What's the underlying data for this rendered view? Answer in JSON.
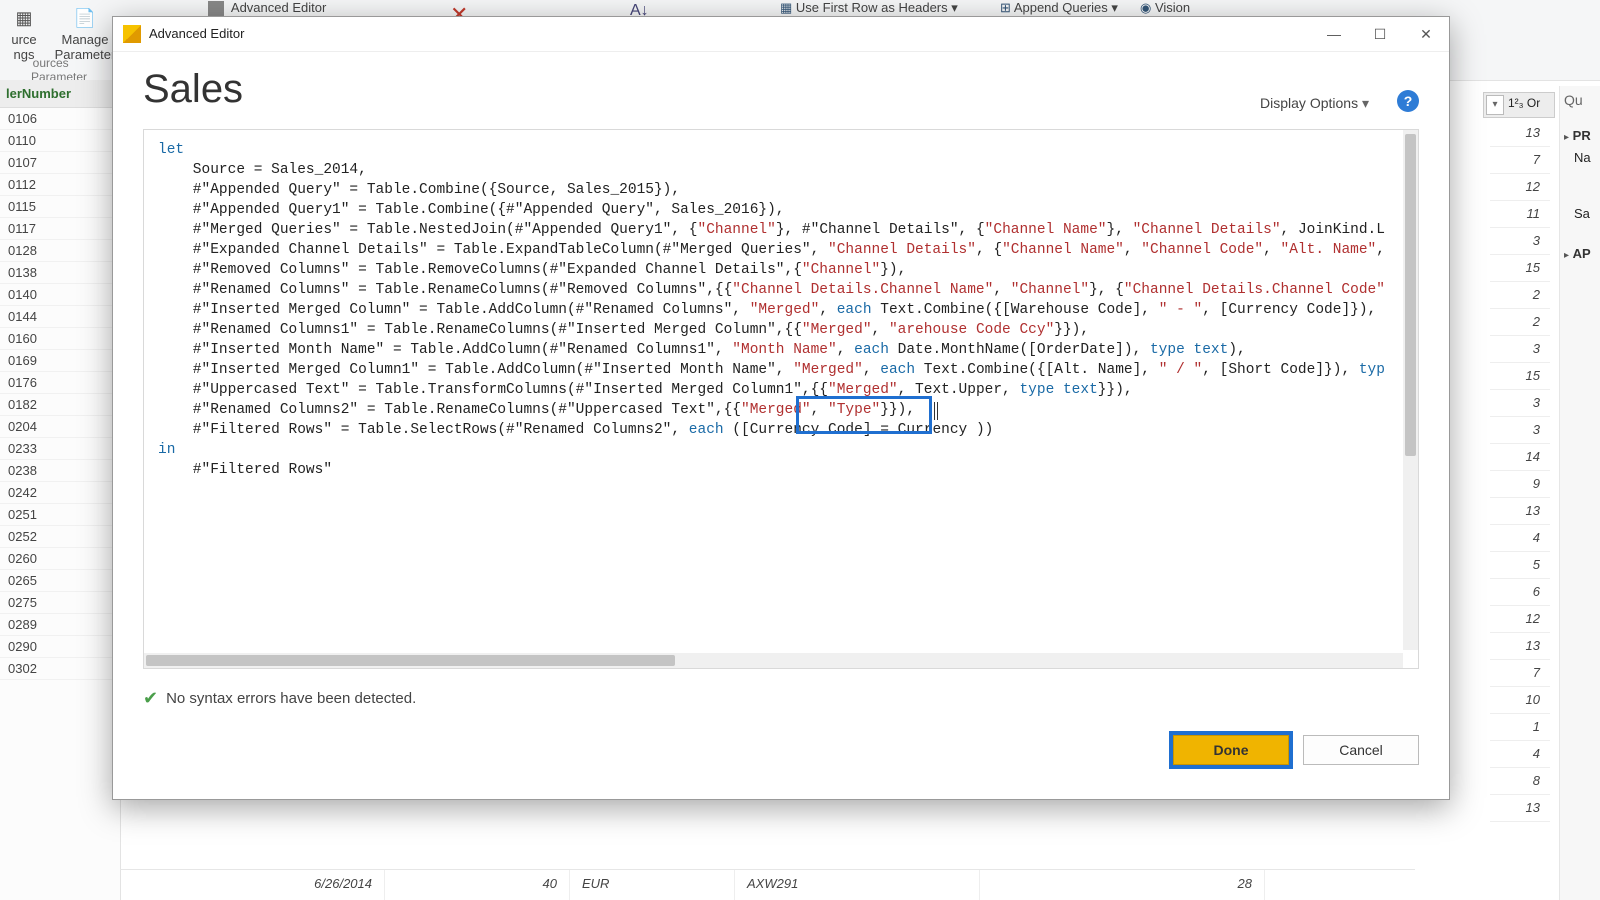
{
  "ribbon": {
    "manage": "Manage\nParameter",
    "sources": "ources",
    "urce": "urce",
    "ngs": "ngs",
    "parameters": "Parameter",
    "advanced_editor": "Advanced Editor",
    "use_first_row": "Use First Row as Headers",
    "append_queries": "Append Queries",
    "vision": "Vision"
  },
  "left": {
    "header": "lerNumber",
    "rows": [
      "0106",
      "0110",
      "0107",
      "0112",
      "0115",
      "0117",
      "0128",
      "0138",
      "0140",
      "0144",
      "0160",
      "0169",
      "0176",
      "0182",
      "0204",
      "0233",
      "0238",
      "0242",
      "0251",
      "0252",
      "0260",
      "0265",
      "0275",
      "0289",
      "0290",
      "0302"
    ]
  },
  "rightcol_header": {
    "dd": "▾",
    "lbl": "1²₃ Or"
  },
  "right_nums": [
    "13",
    "7",
    "12",
    "11",
    "3",
    "15",
    "2",
    "2",
    "3",
    "15",
    "3",
    "3",
    "14",
    "9",
    "13",
    "4",
    "5",
    "6",
    "12",
    "13",
    "7",
    "10",
    "1",
    "4",
    "8",
    "13"
  ],
  "rightpane": {
    "title": "Qu",
    "pr": "PR",
    "na": "Na",
    "sa": "Sa",
    "ap": "AP"
  },
  "bottom": {
    "date": "6/26/2014",
    "qty": "40",
    "ccy": "EUR",
    "code": "AXW291",
    "n": "28"
  },
  "dialog": {
    "title": "Advanced Editor",
    "query_name": "Sales",
    "display_options": "Display Options",
    "status": "No syntax errors have been detected.",
    "done": "Done",
    "cancel": "Cancel"
  },
  "code": {
    "let": "let",
    "l1a": "    Source = Sales_2014,",
    "l2a": "    #\"Appended Query\" = Table.Combine({Source, Sales_2015}),",
    "l3a": "    #\"Appended Query1\" = Table.Combine({#\"Appended Query\", Sales_2016}),",
    "l4p1": "    #\"Merged Queries\" = Table.NestedJoin(#\"Appended Query1\", {",
    "l4s1": "\"Channel\"",
    "l4p2": "}, #\"Channel Details\", {",
    "l4s2": "\"Channel Name\"",
    "l4p3": "}, ",
    "l4s3": "\"Channel Details\"",
    "l4p4": ", JoinKind.L",
    "l5p1": "    #\"Expanded Channel Details\" = Table.ExpandTableColumn(#\"Merged Queries\", ",
    "l5s1": "\"Channel Details\"",
    "l5p2": ", {",
    "l5s2": "\"Channel Name\"",
    "l5p3": ", ",
    "l5s3": "\"Channel Code\"",
    "l5p4": ", ",
    "l5s4": "\"Alt. Name\"",
    "l5p5": ",",
    "l6p1": "    #\"Removed Columns\" = Table.RemoveColumns(#\"Expanded Channel Details\",{",
    "l6s1": "\"Channel\"",
    "l6p2": "}),",
    "l7p1": "    #\"Renamed Columns\" = Table.RenameColumns(#\"Removed Columns\",{{",
    "l7s1": "\"Channel Details.Channel Name\"",
    "l7p2": ", ",
    "l7s2": "\"Channel\"",
    "l7p3": "}, {",
    "l7s3": "\"Channel Details.Channel Code\"",
    "l8p1": "    #\"Inserted Merged Column\" = Table.AddColumn(#\"Renamed Columns\", ",
    "l8s1": "\"Merged\"",
    "l8p2": ", ",
    "l8kw": "each",
    "l8p3": " Text.Combine({[Warehouse Code], ",
    "l8s2": "\" - \"",
    "l8p4": ", [Currency Code]}),",
    "l9p1": "    #\"Renamed Columns1\" = Table.RenameColumns(#\"Inserted Merged Column\",{{",
    "l9s1": "\"Merged\"",
    "l9p2": ", ",
    "l9s2": "\"arehouse Code Ccy\"",
    "l9p3": "}}),",
    "l10p1": "    #\"Inserted Month Name\" = Table.AddColumn(#\"Renamed Columns1\", ",
    "l10s1": "\"Month Name\"",
    "l10p2": ", ",
    "l10kw": "each",
    "l10p3": " Date.MonthName([OrderDate]), ",
    "l10t": "type text",
    "l10p4": "),",
    "l11p1": "    #\"Inserted Merged Column1\" = Table.AddColumn(#\"Inserted Month Name\", ",
    "l11s1": "\"Merged\"",
    "l11p2": ", ",
    "l11kw": "each",
    "l11p3": " Text.Combine({[Alt. Name], ",
    "l11s2": "\" / \"",
    "l11p4": ", [Short Code]}), ",
    "l11t": "typ",
    "l12p1": "    #\"Uppercased Text\" = Table.TransformColumns(#\"Inserted Merged Column1\",{{",
    "l12s1": "\"Merged\"",
    "l12p2": ", Text.Upper, ",
    "l12t": "type text",
    "l12p3": "}}),",
    "l13p1": "    #\"Renamed Columns2\" = Table.RenameColumns(#\"Uppercased Text\",{{",
    "l13s1": "\"Merged\"",
    "l13p2": ", ",
    "l13s2": "\"Type\"",
    "l13p3": "}}),",
    "l14p1": "    #\"Filtered Rows\" = Table.SelectRows(#\"Renamed Columns2\", ",
    "l14kw": "each",
    "l14p2": " ([Currency Code] = Currency ))",
    "in": "in",
    "out": "    #\"Filtered Rows\""
  }
}
